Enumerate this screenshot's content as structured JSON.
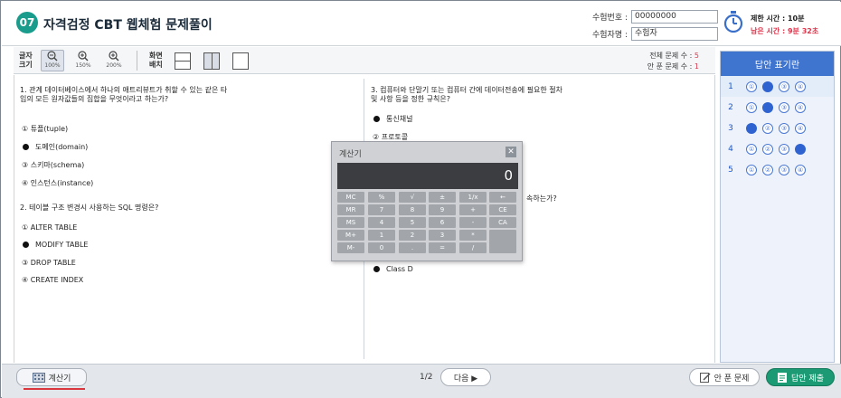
{
  "header": {
    "badge_number": "07",
    "title": "자격검정 CBT 웹체험 문제풀이",
    "candidate_number_label": "수험번호 :",
    "candidate_number_value": "00000000",
    "candidate_name_label": "수험자명 :",
    "candidate_name_value": "수험자",
    "time_limit": "제한 시간 : 10분",
    "time_remaining": "남은 시간 : 9분 32초"
  },
  "toolbar": {
    "font_size_label": "글자\n크기",
    "zoom_options": [
      "100%",
      "150%",
      "200%"
    ],
    "active_zoom": "100%",
    "layout_label": "화면\n배치",
    "total_questions_label": "전체 문제 수 : ",
    "total_questions_value": "5",
    "unsolved_label": "안 푼 문제 수 : ",
    "unsolved_value": "1"
  },
  "questions": [
    {
      "text": "1. 관계 데이터베이스에서 하나의 애트리뷰트가 취할 수 있는 같은 타입의 모든 원자값들의 집합을 무엇이라고 하는가?",
      "options": [
        "① 튜플(tuple)",
        "도메인(domain)",
        "③ 스키마(schema)",
        "④ 인스턴스(instance)"
      ],
      "selected": 2
    },
    {
      "text": "2. 테이블 구조 변경시 사용하는 SQL 명령은?",
      "options": [
        "① ALTER TABLE",
        "MODIFY TABLE",
        "③ DROP TABLE",
        "④ CREATE INDEX"
      ],
      "selected": 2
    },
    {
      "text": "3. 컴퓨터와 단말기 또는 컴퓨터 간에 데이터전송에 필요한 절차 및 사항 등을 정한 규칙은?",
      "options": [
        "통신채널",
        "② 프로토콜"
      ],
      "selected": 1
    },
    {
      "text_fragment": "속하는가?",
      "visible_option": "Class D"
    }
  ],
  "answer_sheet": {
    "title": "답안 표기란",
    "rows": [
      {
        "num": "1",
        "bubbles": [
          "①",
          "②",
          "③",
          "④"
        ],
        "selected": 2
      },
      {
        "num": "2",
        "bubbles": [
          "①",
          "②",
          "③",
          "④"
        ],
        "selected": 2
      },
      {
        "num": "3",
        "bubbles": [
          "①",
          "②",
          "③",
          "④"
        ],
        "selected": 1
      },
      {
        "num": "4",
        "bubbles": [
          "①",
          "②",
          "③",
          "④"
        ],
        "selected": 4
      },
      {
        "num": "5",
        "bubbles": [
          "①",
          "②",
          "③",
          "④"
        ],
        "selected": 0
      }
    ]
  },
  "calculator": {
    "title": "계산기",
    "close": "✕",
    "display": "0",
    "keys": [
      [
        "MC",
        "%",
        "√",
        "±",
        "1/x",
        "←"
      ],
      [
        "MR",
        "7",
        "8",
        "9",
        "+",
        "CE"
      ],
      [
        "MS",
        "4",
        "5",
        "6",
        "-",
        "CA"
      ],
      [
        "M+",
        "1",
        "2",
        "3",
        "*",
        ""
      ],
      [
        "M-",
        "0",
        ".",
        "=",
        "/",
        ""
      ]
    ]
  },
  "bottom": {
    "calc_button": "계산기",
    "page": "1/2",
    "next_button": "다음 ▶",
    "unsolved_button": "안 푼 문제",
    "submit_button": "답안 제출"
  }
}
